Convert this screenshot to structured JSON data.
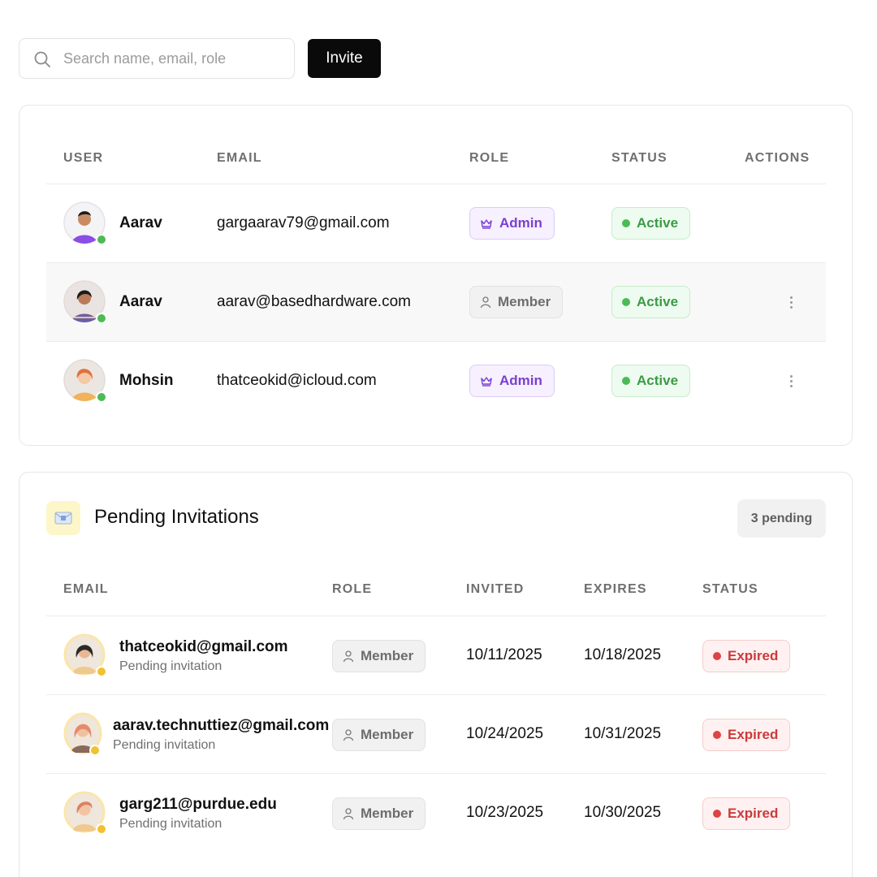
{
  "toolbar": {
    "search_placeholder": "Search name, email, role",
    "search_icon": "search-icon",
    "invite_label": "Invite"
  },
  "users": {
    "columns": [
      "USER",
      "EMAIL",
      "ROLE",
      "STATUS",
      "ACTIONS"
    ],
    "rows": [
      {
        "name": "Aarav",
        "email": "gargaarav79@gmail.com",
        "role": "Admin",
        "role_icon": "crown-icon",
        "status": "Active",
        "has_actions": false,
        "presence": "online"
      },
      {
        "name": "Aarav",
        "email": "aarav@basedhardware.com",
        "role": "Member",
        "role_icon": "user-icon",
        "status": "Active",
        "has_actions": true,
        "presence": "online"
      },
      {
        "name": "Mohsin",
        "email": "thatceokid@icloud.com",
        "role": "Admin",
        "role_icon": "crown-icon",
        "status": "Active",
        "has_actions": true,
        "presence": "online"
      }
    ]
  },
  "invitations": {
    "title": "Pending Invitations",
    "icon": "envelope-icon",
    "count_label": "3 pending",
    "columns": [
      "EMAIL",
      "ROLE",
      "INVITED",
      "EXPIRES",
      "STATUS"
    ],
    "rows": [
      {
        "email": "thatceokid@gmail.com",
        "subtitle": "Pending invitation",
        "role": "Member",
        "role_icon": "user-icon",
        "invited": "10/11/2025",
        "expires": "10/18/2025",
        "status": "Expired"
      },
      {
        "email": "aarav.technuttiez@gmail.com",
        "subtitle": "Pending invitation",
        "role": "Member",
        "role_icon": "user-icon",
        "invited": "10/24/2025",
        "expires": "10/31/2025",
        "status": "Expired"
      },
      {
        "email": "garg211@purdue.edu",
        "subtitle": "Pending invitation",
        "role": "Member",
        "role_icon": "user-icon",
        "invited": "10/23/2025",
        "expires": "10/30/2025",
        "status": "Expired"
      }
    ]
  },
  "colors": {
    "admin": "#7b3fd0",
    "active": "#3a9b46",
    "expired": "#cc3a3a",
    "online_dot": "#4cbb55",
    "pending_dot": "#f2c12e",
    "invite_button": "#0a0a0a"
  }
}
